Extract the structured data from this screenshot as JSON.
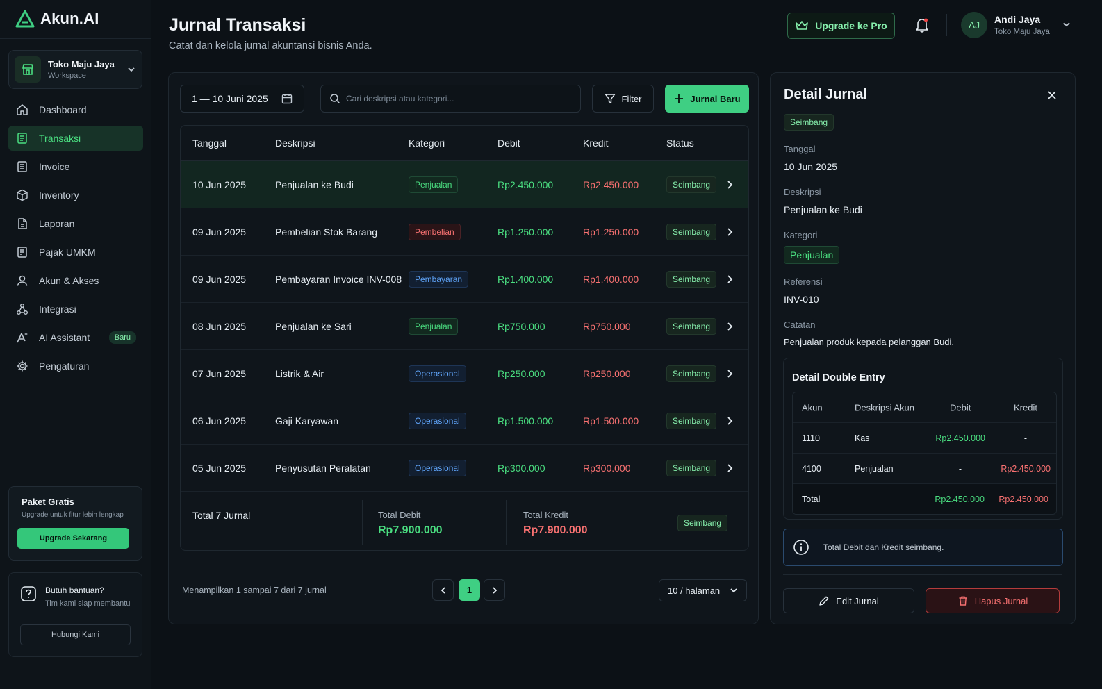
{
  "app": {
    "name": "Akun.AI"
  },
  "workspace": {
    "name": "Toko Maju Jaya",
    "sub": "Workspace"
  },
  "sidebar": {
    "items": [
      {
        "label": "Dashboard",
        "icon": "home-icon"
      },
      {
        "label": "Transaksi",
        "icon": "document-icon",
        "active": true
      },
      {
        "label": "Invoice",
        "icon": "invoice-icon"
      },
      {
        "label": "Inventory",
        "icon": "box-icon"
      },
      {
        "label": "Laporan",
        "icon": "report-icon"
      },
      {
        "label": "Pajak UMKM",
        "icon": "tax-icon"
      },
      {
        "label": "Akun & Akses",
        "icon": "user-icon"
      },
      {
        "label": "Integrasi",
        "icon": "integration-icon"
      },
      {
        "label": "AI Assistant",
        "icon": "ai-sparkle-icon",
        "badge": "Baru"
      },
      {
        "label": "Pengaturan",
        "icon": "gear-icon"
      }
    ]
  },
  "promo": {
    "title": "Paket Gratis",
    "sub": "Upgrade untuk fitur lebih lengkap",
    "button": "Upgrade Sekarang"
  },
  "help": {
    "title": "Butuh bantuan?",
    "sub": "Tim kami siap membantu",
    "button": "Hubungi Kami"
  },
  "header": {
    "title": "Jurnal Transaksi",
    "subtitle": "Catat dan kelola jurnal akuntansi bisnis Anda.",
    "upgrade": "Upgrade ke Pro",
    "user": {
      "initials": "AJ",
      "name": "Andi Jaya",
      "company": "Toko Maju Jaya"
    }
  },
  "toolbar": {
    "date_range": "1 — 10 Juni 2025",
    "search_placeholder": "Cari deskripsi atau kategori...",
    "filter": "Filter",
    "new_journal": "Jurnal Baru"
  },
  "table": {
    "headers": {
      "date": "Tanggal",
      "desc": "Deskripsi",
      "category": "Kategori",
      "debit": "Debit",
      "credit": "Kredit",
      "status": "Status"
    },
    "rows": [
      {
        "date": "10 Jun 2025",
        "desc": "Penjualan ke Budi",
        "category": "Penjualan",
        "cat_type": "penjualan",
        "debit": "Rp2.450.000",
        "credit": "Rp2.450.000",
        "status": "Seimbang"
      },
      {
        "date": "09 Jun 2025",
        "desc": "Pembelian Stok Barang",
        "category": "Pembelian",
        "cat_type": "pembelian",
        "debit": "Rp1.250.000",
        "credit": "Rp1.250.000",
        "status": "Seimbang"
      },
      {
        "date": "09 Jun 2025",
        "desc": "Pembayaran Invoice INV-008",
        "category": "Pembayaran",
        "cat_type": "pembayaran",
        "debit": "Rp1.400.000",
        "credit": "Rp1.400.000",
        "status": "Seimbang"
      },
      {
        "date": "08 Jun 2025",
        "desc": "Penjualan ke Sari",
        "category": "Penjualan",
        "cat_type": "penjualan",
        "debit": "Rp750.000",
        "credit": "Rp750.000",
        "status": "Seimbang"
      },
      {
        "date": "07 Jun 2025",
        "desc": "Listrik & Air",
        "category": "Operasional",
        "cat_type": "operasional",
        "debit": "Rp250.000",
        "credit": "Rp250.000",
        "status": "Seimbang"
      },
      {
        "date": "06 Jun 2025",
        "desc": "Gaji Karyawan",
        "category": "Operasional",
        "cat_type": "operasional",
        "debit": "Rp1.500.000",
        "credit": "Rp1.500.000",
        "status": "Seimbang"
      },
      {
        "date": "05 Jun 2025",
        "desc": "Penyusutan Peralatan",
        "category": "Operasional",
        "cat_type": "operasional",
        "debit": "Rp300.000",
        "credit": "Rp300.000",
        "status": "Seimbang"
      }
    ],
    "footer": {
      "total_label": "Total 7 Jurnal",
      "total_debit_label": "Total Debit",
      "total_debit": "Rp7.900.000",
      "total_credit_label": "Total Kredit",
      "total_credit": "Rp7.900.000",
      "status": "Seimbang"
    }
  },
  "pagination": {
    "showing": "Menampilkan 1 sampai 7 dari 7 jurnal",
    "page": "1",
    "per_page": "10 / halaman"
  },
  "detail": {
    "title": "Detail Jurnal",
    "status": "Seimbang",
    "date_label": "Tanggal",
    "date": "10 Jun 2025",
    "desc_label": "Deskripsi",
    "desc": "Penjualan ke Budi",
    "category_label": "Kategori",
    "category": "Penjualan",
    "ref_label": "Referensi",
    "ref": "INV-010",
    "note_label": "Catatan",
    "note": "Penjualan produk kepada pelanggan Budi.",
    "double_entry": {
      "title": "Detail Double Entry",
      "headers": {
        "account": "Akun",
        "account_desc": "Deskripsi Akun",
        "debit": "Debit",
        "credit": "Kredit"
      },
      "rows": [
        {
          "account": "1110",
          "desc": "Kas",
          "debit": "Rp2.450.000",
          "credit": "-"
        },
        {
          "account": "4100",
          "desc": "Penjualan",
          "debit": "-",
          "credit": "Rp2.450.000"
        }
      ],
      "total": {
        "label": "Total",
        "debit": "Rp2.450.000",
        "credit": "Rp2.450.000"
      }
    },
    "info": "Total Debit dan Kredit seimbang.",
    "edit": "Edit Jurnal",
    "delete": "Hapus Jurnal"
  },
  "colors": {
    "accent": "#3fcf83",
    "debit": "#4ade80",
    "credit": "#f87171",
    "background": "#0c1116"
  }
}
